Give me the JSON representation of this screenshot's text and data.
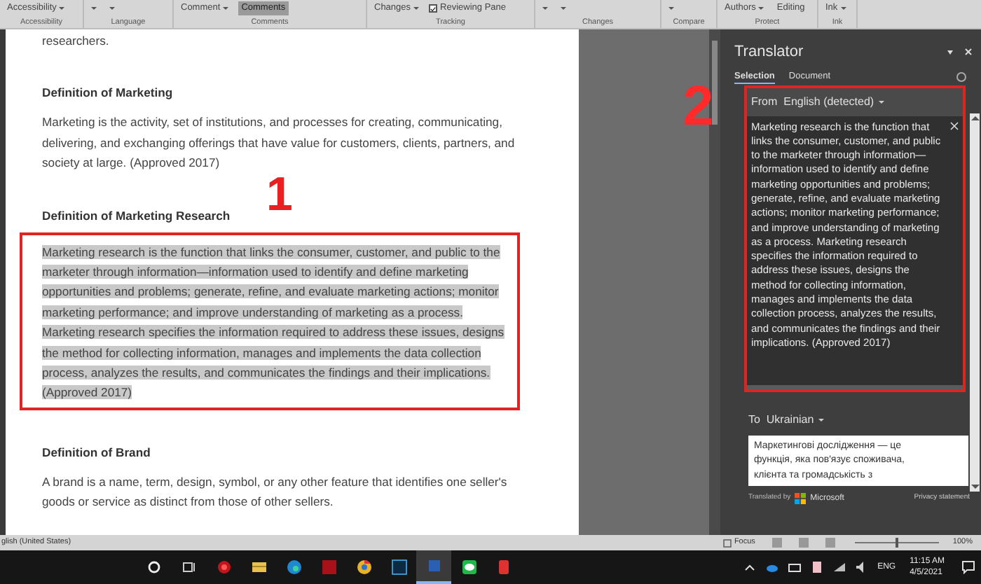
{
  "ribbon": {
    "groups": [
      {
        "label": "Accessibility",
        "commands": [
          {
            "kind": "dropdown",
            "label": "Accessibility",
            "selected": false
          }
        ]
      },
      {
        "label": "Language",
        "commands": [
          {
            "kind": "dropdown",
            "selected": false
          },
          {
            "kind": "dropdown",
            "selected": false
          }
        ]
      },
      {
        "label": "Comments",
        "commands": [
          {
            "kind": "dropdown",
            "label": "Comment",
            "selected": false
          },
          {
            "kind": "button",
            "label": "Comments",
            "selected": true
          }
        ]
      },
      {
        "label": "Tracking",
        "commands": [
          {
            "kind": "dropdown",
            "label": "Changes",
            "selected": false
          },
          {
            "kind": "checkbox",
            "label": "Reviewing Pane",
            "checked": true
          }
        ]
      },
      {
        "label": "Changes",
        "commands": [
          {
            "kind": "dropdown",
            "selected": false
          },
          {
            "kind": "dropdown",
            "selected": false
          }
        ]
      },
      {
        "label": "Compare",
        "commands": [
          {
            "kind": "dropdown",
            "selected": false
          }
        ]
      },
      {
        "label": "Protect",
        "commands": [
          {
            "kind": "dropdown",
            "label": "Authors",
            "selected": false
          },
          {
            "kind": "button",
            "label": "Editing",
            "selected": false
          }
        ]
      },
      {
        "label": "Ink",
        "commands": [
          {
            "kind": "dropdown",
            "label": "Ink",
            "selected": false
          }
        ]
      }
    ]
  },
  "document": {
    "blocks": [
      {
        "kind": "text",
        "text": "researchers.",
        "highlighted": false
      },
      {
        "kind": "heading",
        "text": "Definition of Marketing",
        "highlighted": false
      },
      {
        "kind": "text",
        "text": "Marketing is the activity, set of institutions, and processes for creating, communicating, delivering, and exchanging offerings that have value for customers, clients, partners, and society at large. (Approved 2017)",
        "highlighted": false
      },
      {
        "kind": "heading",
        "text": "Definition of Marketing Research",
        "highlighted": false
      },
      {
        "kind": "text",
        "text": "Marketing research is the function that links the consumer, customer, and public to the marketer through information—information used to identify and define marketing opportunities and problems; generate, refine, and evaluate marketing actions; monitor marketing performance; and improve understanding of marketing as a process. Marketing research specifies the information required to address these issues, designs the method for collecting information, manages and implements the data collection process, analyzes the results, and communicates the findings and their implications. (Approved 2017)",
        "highlighted": true
      },
      {
        "kind": "heading",
        "text": "Definition of Brand",
        "highlighted": false
      },
      {
        "kind": "text",
        "text": "A brand is a name, term, design, symbol, or any other feature that identifies one seller's goods or service as distinct from those of other sellers.",
        "highlighted": false
      }
    ]
  },
  "callouts": [
    {
      "label": "1"
    },
    {
      "label": "2"
    }
  ],
  "translator": {
    "title": "Translator",
    "tabs": [
      {
        "label": "Selection",
        "selected": true
      },
      {
        "label": "Document",
        "selected": false
      }
    ],
    "from": "From  English (detected)",
    "source_text": "Marketing research is the function that links the consumer, customer, and public to the marketer through information—information used to identify and define marketing opportunities and problems; generate, refine, and evaluate marketing actions; monitor marketing performance; and improve understanding of marketing as a process. Marketing research specifies the information required to address these issues, designs the method for collecting information, manages and implements the data collection process, analyzes the results, and communicates the findings and their implications. (Approved 2017)",
    "to": "To  Ukrainian",
    "target_text": "Маркетингові дослідження — це функція, яка пов'язує споживача, клієнта та громадськість з",
    "translated_by": "Translated by",
    "provider": "Microsoft",
    "privacy": "Privacy statement"
  },
  "status_bar": {
    "language": "glish (United States)",
    "focus": "Focus",
    "zoom": "100%",
    "level": 0.5
  },
  "taskbar": {
    "apps": [
      {
        "kind": "search",
        "active": false
      },
      {
        "kind": "taskview",
        "active": false
      },
      {
        "kind": "redcircle",
        "active": false
      },
      {
        "kind": "folder",
        "active": false
      },
      {
        "kind": "edge",
        "active": false
      },
      {
        "kind": "redapp",
        "active": false
      },
      {
        "kind": "chrome",
        "active": false
      },
      {
        "kind": "ps",
        "active": false
      },
      {
        "kind": "word",
        "active": true
      },
      {
        "kind": "chat",
        "active": false
      },
      {
        "kind": "redapp2",
        "active": false
      }
    ],
    "language": "ENG",
    "time": "11:15 AM",
    "date": "4/5/2021"
  }
}
